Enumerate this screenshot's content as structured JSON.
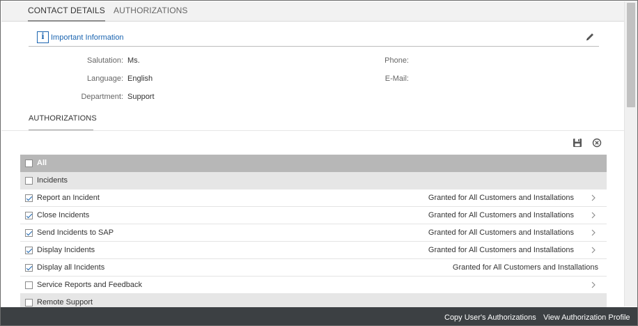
{
  "tabs": [
    {
      "label": "CONTACT DETAILS",
      "active": true
    },
    {
      "label": "AUTHORIZATIONS",
      "active": false
    }
  ],
  "info": {
    "icon": "info-icon",
    "glyph": "i",
    "title": "Important Information"
  },
  "contact": {
    "salutation_label": "Salutation:",
    "salutation_value": "Ms.",
    "language_label": "Language:",
    "language_value": "English",
    "department_label": "Department:",
    "department_value": "Support",
    "phone_label": "Phone:",
    "email_label": "E-Mail:"
  },
  "authorizations": {
    "title": "AUTHORIZATIONS",
    "rows": [
      {
        "label": "All",
        "type": "all",
        "checked": false,
        "status": "",
        "arrow": false
      },
      {
        "label": "Incidents",
        "type": "group",
        "checked": false,
        "status": "",
        "arrow": false
      },
      {
        "label": "Report an Incident",
        "type": "item",
        "checked": true,
        "status": "Granted for All Customers and Installations",
        "arrow": true
      },
      {
        "label": "Close Incidents",
        "type": "item",
        "checked": true,
        "status": "Granted for All Customers and Installations",
        "arrow": true
      },
      {
        "label": "Send Incidents to SAP",
        "type": "item",
        "checked": true,
        "status": "Granted for All Customers and Installations",
        "arrow": true
      },
      {
        "label": "Display Incidents",
        "type": "item",
        "checked": true,
        "status": "Granted for All Customers and Installations",
        "arrow": true
      },
      {
        "label": "Display all Incidents",
        "type": "item",
        "checked": true,
        "status": "Granted for All Customers and Installations",
        "arrow": false
      },
      {
        "label": "Service Reports and Feedback",
        "type": "item",
        "checked": false,
        "status": "",
        "arrow": true
      },
      {
        "label": "Remote Support",
        "type": "group",
        "checked": false,
        "status": "",
        "arrow": false
      }
    ]
  },
  "footer": {
    "copy_label": "Copy User's Authorizations",
    "view_label": "View Authorization Profile"
  },
  "colors": {
    "accent": "#1a64b0",
    "footer_bg": "#3c4043",
    "all_row_bg": "#b7b7b7",
    "group_row_bg": "#e6e6e6"
  }
}
